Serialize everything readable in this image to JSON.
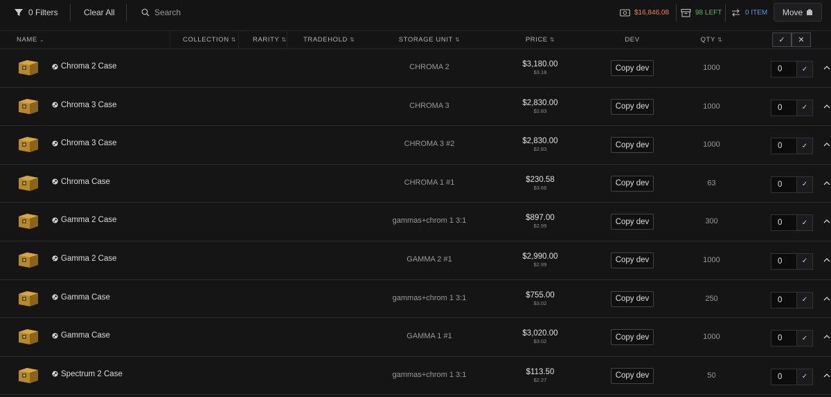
{
  "toolbar": {
    "filters_label": "0 Filters",
    "clear_label": "Clear All",
    "search_placeholder": "Search",
    "total_value": "$16,846.08",
    "slots_left": "98 LEFT",
    "item_count": "0 ITEM",
    "move_label": "Move",
    "colors": {
      "value": "#e7894b",
      "left": "#59b26b",
      "items": "#5f97e6"
    }
  },
  "columns": {
    "name": "NAME",
    "collection": "COLLECTION",
    "rarity": "RARITY",
    "tradehold": "TRADEHOLD",
    "storage": "STORAGE UNIT",
    "price": "PRICE",
    "dev": "DEV",
    "qty": "QTY"
  },
  "rows": [
    {
      "name": "Chroma 2 Case",
      "storage": "CHROMA 2",
      "price": "$3,180.00",
      "unit_price": "$3.18",
      "dev_label": "Copy dev",
      "qty": "1000",
      "input": "0"
    },
    {
      "name": "Chroma 3 Case",
      "storage": "CHROMA 3",
      "price": "$2,830.00",
      "unit_price": "$2.83",
      "dev_label": "Copy dev",
      "qty": "1000",
      "input": "0"
    },
    {
      "name": "Chroma 3 Case",
      "storage": "CHROMA 3 #2",
      "price": "$2,830.00",
      "unit_price": "$2.83",
      "dev_label": "Copy dev",
      "qty": "1000",
      "input": "0"
    },
    {
      "name": "Chroma Case",
      "storage": "CHROMA 1 #1",
      "price": "$230.58",
      "unit_price": "$3.66",
      "dev_label": "Copy dev",
      "qty": "63",
      "input": "0"
    },
    {
      "name": "Gamma 2 Case",
      "storage": "gammas+chrom 1 3:1",
      "price": "$897.00",
      "unit_price": "$2.99",
      "dev_label": "Copy dev",
      "qty": "300",
      "input": "0"
    },
    {
      "name": "Gamma 2 Case",
      "storage": "GAMMA 2 #1",
      "price": "$2,990.00",
      "unit_price": "$2.99",
      "dev_label": "Copy dev",
      "qty": "1000",
      "input": "0"
    },
    {
      "name": "Gamma Case",
      "storage": "gammas+chrom 1 3:1",
      "price": "$755.00",
      "unit_price": "$3.02",
      "dev_label": "Copy dev",
      "qty": "250",
      "input": "0"
    },
    {
      "name": "Gamma Case",
      "storage": "GAMMA 1 #1",
      "price": "$3,020.00",
      "unit_price": "$3.02",
      "dev_label": "Copy dev",
      "qty": "1000",
      "input": "0"
    },
    {
      "name": "Spectrum 2 Case",
      "storage": "gammas+chrom 1 3:1",
      "price": "$113.50",
      "unit_price": "$2.27",
      "dev_label": "Copy dev",
      "qty": "50",
      "input": "0"
    }
  ]
}
